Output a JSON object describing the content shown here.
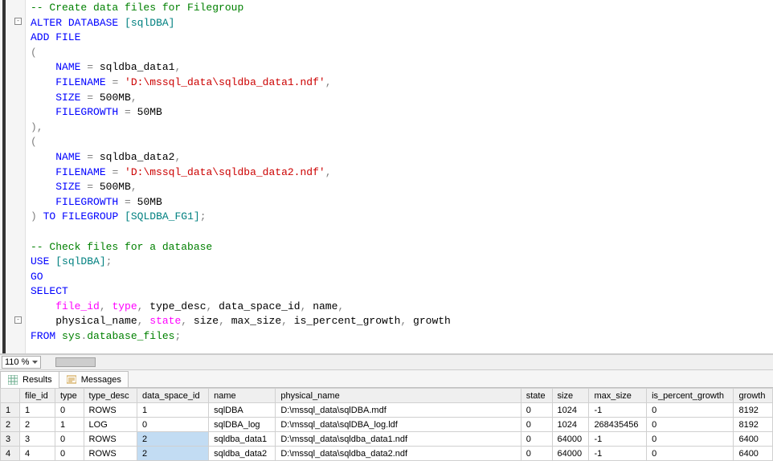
{
  "code": {
    "c1": "-- Create data files for Filegroup",
    "alter": "ALTER",
    "database": "DATABASE",
    "db_name": "[sqlDBA]",
    "add_file": "ADD FILE",
    "lparen1": "(",
    "name_kw": "NAME",
    "eq": " = ",
    "name1": "sqldba_data1",
    "comma": ",",
    "filename_kw": "FILENAME",
    "filename1": "'D:\\mssql_data\\sqldba_data1.ndf'",
    "size_kw": "SIZE",
    "size_val": "500MB",
    "filegrowth_kw": "FILEGROWTH",
    "fg_val": "50MB",
    "rparen_comma": "),",
    "lparen2": "(",
    "name2": "sqldba_data2",
    "filename2": "'D:\\mssql_data\\sqldba_data2.ndf'",
    "rparen": ")",
    "to_filegroup": "TO FILEGROUP",
    "fg_name": "[SQLDBA_FG1]",
    "semi": ";",
    "c2": "-- Check files for a database",
    "use": "USE",
    "go": "GO",
    "select": "SELECT",
    "sel_cols1_a": "file_id",
    "sel_cols1_b": "type",
    "sel_cols1_c": "type_desc",
    "sel_cols1_d": "data_space_id",
    "sel_cols1_e": "name",
    "sel_cols2_a": "physical_name",
    "sel_cols2_b": "state",
    "sel_cols2_c": "size",
    "sel_cols2_d": "max_size",
    "sel_cols2_e": "is_percent_growth",
    "sel_cols2_f": "growth",
    "from": "FROM",
    "sys": "sys",
    "dot": ".",
    "dbfiles": "database_files"
  },
  "zoom": "110 %",
  "tabs": {
    "results": "Results",
    "messages": "Messages"
  },
  "grid": {
    "headers": [
      "file_id",
      "type",
      "type_desc",
      "data_space_id",
      "name",
      "physical_name",
      "state",
      "size",
      "max_size",
      "is_percent_growth",
      "growth"
    ],
    "rows": [
      {
        "n": "1",
        "file_id": "1",
        "type": "0",
        "type_desc": "ROWS",
        "data_space_id": "1",
        "name": "sqlDBA",
        "physical_name": "D:\\mssql_data\\sqlDBA.mdf",
        "state": "0",
        "size": "1024",
        "max_size": "-1",
        "is_percent_growth": "0",
        "growth": "8192"
      },
      {
        "n": "2",
        "file_id": "2",
        "type": "1",
        "type_desc": "LOG",
        "data_space_id": "0",
        "name": "sqlDBA_log",
        "physical_name": "D:\\mssql_data\\sqlDBA_log.ldf",
        "state": "0",
        "size": "1024",
        "max_size": "268435456",
        "is_percent_growth": "0",
        "growth": "8192"
      },
      {
        "n": "3",
        "file_id": "3",
        "type": "0",
        "type_desc": "ROWS",
        "data_space_id": "2",
        "name": "sqldba_data1",
        "physical_name": "D:\\mssql_data\\sqldba_data1.ndf",
        "state": "0",
        "size": "64000",
        "max_size": "-1",
        "is_percent_growth": "0",
        "growth": "6400"
      },
      {
        "n": "4",
        "file_id": "4",
        "type": "0",
        "type_desc": "ROWS",
        "data_space_id": "2",
        "name": "sqldba_data2",
        "physical_name": "D:\\mssql_data\\sqldba_data2.ndf",
        "state": "0",
        "size": "64000",
        "max_size": "-1",
        "is_percent_growth": "0",
        "growth": "6400"
      }
    ]
  },
  "chart_data": {
    "type": "table",
    "title": "sys.database_files",
    "columns": [
      "file_id",
      "type",
      "type_desc",
      "data_space_id",
      "name",
      "physical_name",
      "state",
      "size",
      "max_size",
      "is_percent_growth",
      "growth"
    ],
    "rows": [
      [
        1,
        0,
        "ROWS",
        1,
        "sqlDBA",
        "D:\\mssql_data\\sqlDBA.mdf",
        0,
        1024,
        -1,
        0,
        8192
      ],
      [
        2,
        1,
        "LOG",
        0,
        "sqlDBA_log",
        "D:\\mssql_data\\sqlDBA_log.ldf",
        0,
        1024,
        268435456,
        0,
        8192
      ],
      [
        3,
        0,
        "ROWS",
        2,
        "sqldba_data1",
        "D:\\mssql_data\\sqldba_data1.ndf",
        0,
        64000,
        -1,
        0,
        6400
      ],
      [
        4,
        0,
        "ROWS",
        2,
        "sqldba_data2",
        "D:\\mssql_data\\sqldba_data2.ndf",
        0,
        64000,
        -1,
        0,
        6400
      ]
    ]
  }
}
